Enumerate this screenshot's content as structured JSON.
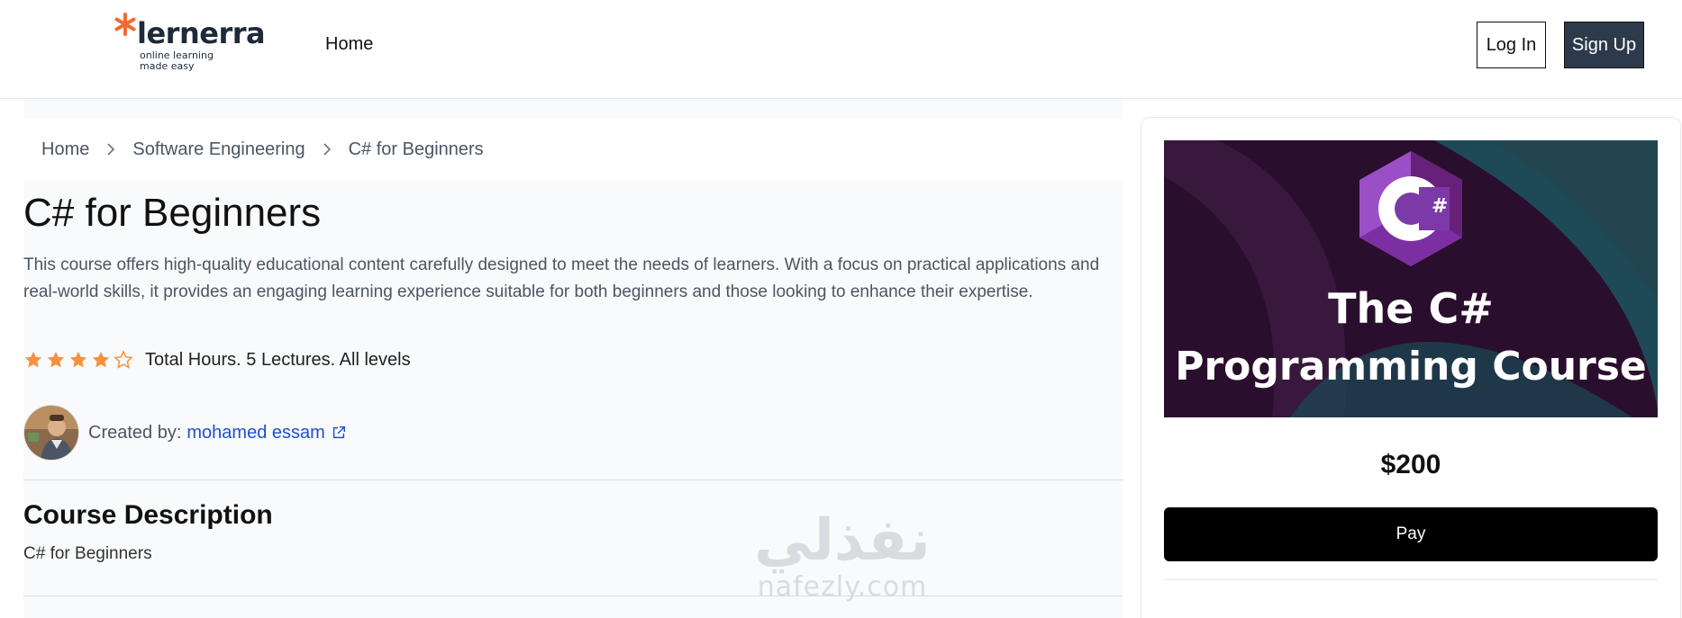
{
  "header": {
    "logo_word": "lernerra",
    "logo_tagline": "online learning made easy",
    "nav_home": "Home",
    "login_label": "Log In",
    "signup_label": "Sign Up"
  },
  "breadcrumb": [
    "Home",
    "Software Engineering",
    "C# for Beginners"
  ],
  "course": {
    "title": "C# for Beginners",
    "description": "This course offers high-quality educational content carefully designed to meet the needs of learners. With a focus on practical applications and real-world skills, it provides an engaging learning experience suitable for both beginners and those looking to enhance their expertise.",
    "rating": 4,
    "rating_max": 5,
    "meta": "Total Hours. 5 Lectures. All levels",
    "created_by_label": "Created by:",
    "creator_name": "mohamed essam",
    "section_title": "Course Description",
    "section_body": "C# for Beginners"
  },
  "card": {
    "banner_line1": "The C#",
    "banner_line2": "Programming Course",
    "price": "$200",
    "pay_label": "Pay"
  },
  "watermark": {
    "arabic": "نفذلي",
    "latin": "nafezly.com"
  },
  "colors": {
    "accent_star": "#f5913e",
    "logo_star": "#f26a2e",
    "link": "#1d4ed8",
    "signup_bg": "#2d3a4b",
    "pay_bg": "#000000",
    "csharp_purple": "#68217a"
  },
  "icons": {
    "logo": "asterisk-star-icon",
    "breadcrumb_separator": "chevron-right-icon",
    "rating": "star-icon",
    "external_link": "external-link-icon"
  }
}
